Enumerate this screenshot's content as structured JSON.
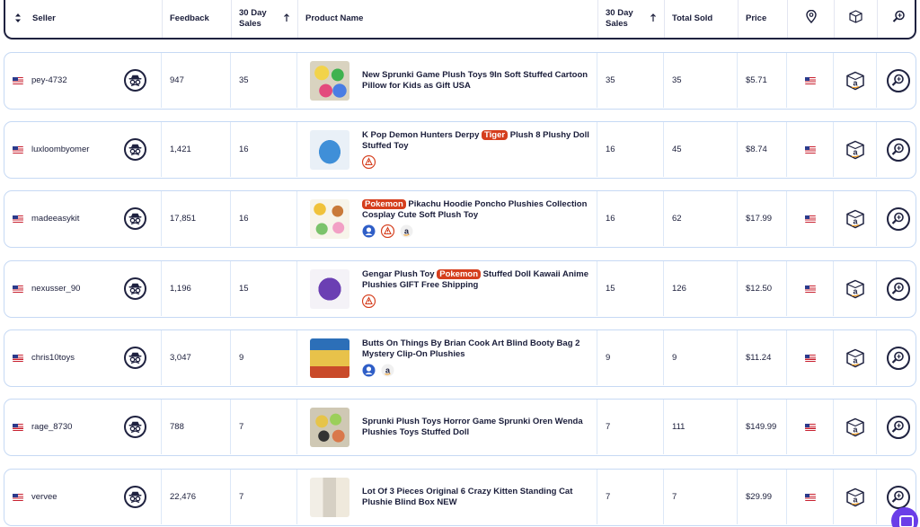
{
  "header": {
    "seller": "Seller",
    "feedback": "Feedback",
    "sales30_a": "30 Day",
    "sales30_b": "Sales",
    "product": "Product Name",
    "sales30b_a": "30 Day",
    "sales30b_b": "Sales",
    "total_sold": "Total Sold",
    "price": "Price"
  },
  "rows": [
    {
      "seller": "pey-4732",
      "feedback": "947",
      "sales30": "35",
      "title": [
        "New Sprunki Game Plush Toys 9In Soft Stuffed Cartoon Pillow for Kids as Gift USA"
      ],
      "sales30b": "35",
      "total_sold": "35",
      "price": "$5.71"
    },
    {
      "seller": "luxloombyomer",
      "feedback": "1,421",
      "sales30": "16",
      "title": [
        "K Pop Demon Hunters Derpy ",
        "Tiger",
        " Plush 8 Plushy Doll Stuffed Toy"
      ],
      "sales30b": "16",
      "total_sold": "45",
      "price": "$8.74"
    },
    {
      "seller": "madeeasykit",
      "feedback": "17,851",
      "sales30": "16",
      "title": [
        "",
        "Pokemon",
        " Pikachu Hoodie Poncho Plushies Collection Cosplay Cute Soft Plush Toy"
      ],
      "sales30b": "16",
      "total_sold": "62",
      "price": "$17.99"
    },
    {
      "seller": "nexusser_90",
      "feedback": "1,196",
      "sales30": "15",
      "title": [
        "Gengar Plush Toy ",
        "Pokemon",
        " Stuffed Doll Kawaii Anime Plushies GIFT Free Shipping"
      ],
      "sales30b": "15",
      "total_sold": "126",
      "price": "$12.50"
    },
    {
      "seller": "chris10toys",
      "feedback": "3,047",
      "sales30": "9",
      "title": [
        "Butts On Things By Brian Cook Art Blind Booty Bag 2 Mystery Clip-On Plushies"
      ],
      "sales30b": "9",
      "total_sold": "9",
      "price": "$11.24"
    },
    {
      "seller": "rage_8730",
      "feedback": "788",
      "sales30": "7",
      "title": [
        "Sprunki Plush Toys Horror Game Sprunki Oren Wenda Plushies Toys Stuffed Doll"
      ],
      "sales30b": "7",
      "total_sold": "111",
      "price": "$149.99"
    },
    {
      "seller": "vervee",
      "feedback": "22,476",
      "sales30": "7",
      "title": [
        "Lot Of 3 Pieces Original 6 Crazy Kitten Standing Cat Plushie Blind Box NEW"
      ],
      "sales30b": "7",
      "total_sold": "7",
      "price": "$29.99"
    }
  ],
  "icons": {
    "location": "location-pin-icon",
    "package": "package-box-icon",
    "search": "magnifier-icon",
    "spy": "spy-icon",
    "amazon": "amazon-icon",
    "warning": "warning-icon",
    "vero": "vero-icon"
  },
  "colors": {
    "accent": "#1f2240",
    "keyword": "#d53e1d",
    "row_border": "#c6d9f4",
    "chat": "#6a3ee8"
  }
}
